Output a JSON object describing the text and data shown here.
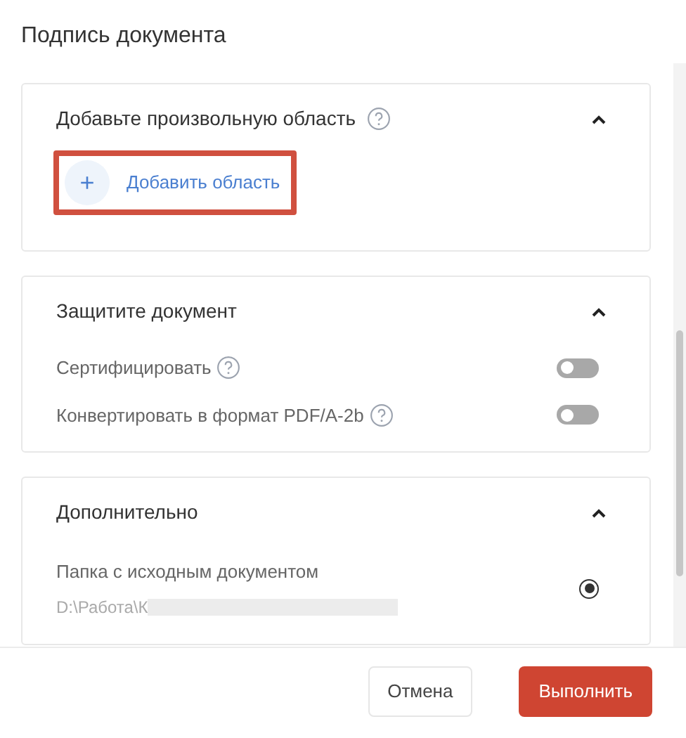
{
  "title": "Подпись документа",
  "sections": [
    {
      "kind": "add_area",
      "title": "Добавьте произвольную область",
      "help": true,
      "expanded": true,
      "add_button": {
        "icon": "+",
        "label": "Добавить область",
        "highlighted": true
      }
    },
    {
      "kind": "toggles",
      "title": "Защитите документ",
      "help": false,
      "expanded": true,
      "toggles": [
        {
          "label": "Сертифицировать",
          "help": true,
          "on": false
        },
        {
          "label": "Конвертировать в формат PDF/A-2b",
          "help": true,
          "on": false
        }
      ]
    },
    {
      "kind": "options",
      "title": "Дополнительно",
      "help": false,
      "expanded": true,
      "options": [
        {
          "label": "Папка с исходным документом",
          "path": "D:\\Работа\\К",
          "redacted": true,
          "selected": true
        }
      ]
    }
  ],
  "buttons": [
    {
      "kind": "secondary",
      "label": "Отмена"
    },
    {
      "kind": "primary",
      "label": "Выполнить"
    }
  ]
}
